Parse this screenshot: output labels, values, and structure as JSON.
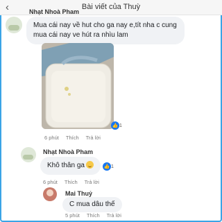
{
  "header": {
    "title": "Bài viết của Thuỳ",
    "back_icon": "back-arrow-icon"
  },
  "comments": [
    {
      "author": "Nhạt Nhoà Pham",
      "text": "Mua cái nay về hut cho ga nay e,tít nha c cung mua cái nay ve hút ra nhìu lam",
      "time": "6 phút",
      "like": "Thích",
      "reply": "Trả lời",
      "reaction_count": "1",
      "reaction_icon": "like-icon"
    },
    {
      "author": "Nhạt Nhoà Pham",
      "text": "Khô thân ga",
      "emoji_icon": "laughing-emoji-icon",
      "time": "6 phút",
      "like": "Thích",
      "reply": "Trả lời",
      "reaction_count": "1",
      "reaction_icon": "like-icon"
    },
    {
      "author": "Mai Thuỷ",
      "text": "C mua dâu thế",
      "time": "5 phút",
      "like": "Thích",
      "reply": "Trả lời"
    }
  ],
  "colors": {
    "frame": "#3aa4e6",
    "bubble": "#f0f2f5",
    "like": "#1877f2"
  }
}
